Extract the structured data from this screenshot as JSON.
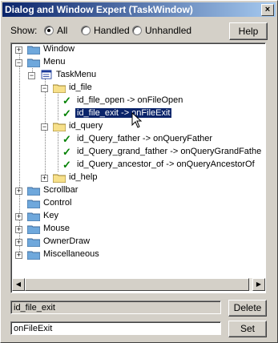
{
  "window": {
    "title": "Dialog and Window Expert (TaskWindow)",
    "close": "×"
  },
  "filter": {
    "label": "Show:",
    "options": [
      "All",
      "Handled",
      "Unhandled"
    ],
    "selected": "All"
  },
  "help_label": "Help",
  "tree": {
    "window": "Window",
    "menu": "Menu",
    "taskmenu": "TaskMenu",
    "id_file": "id_file",
    "file_open": "id_file_open -> onFileOpen",
    "file_exit": "id_file_exit -> onFileExit",
    "id_query": "id_query",
    "q_father": "id_Query_father -> onQueryFather",
    "q_grand": "id_Query_grand_father -> onQueryGrandFathe",
    "q_anc": "id_Query_ancestor_of -> onQueryAncestorOf",
    "id_help": "id_help",
    "scrollbar": "Scrollbar",
    "control": "Control",
    "key": "Key",
    "mouse": "Mouse",
    "ownerdraw": "OwnerDraw",
    "misc": "Miscellaneous"
  },
  "selected_id_value": "id_file_exit",
  "handler_value": "onFileExit",
  "delete_label": "Delete",
  "set_label": "Set",
  "colors": {
    "selection": "#0a246a",
    "check": "#008000",
    "folder": "#f7e08a"
  }
}
